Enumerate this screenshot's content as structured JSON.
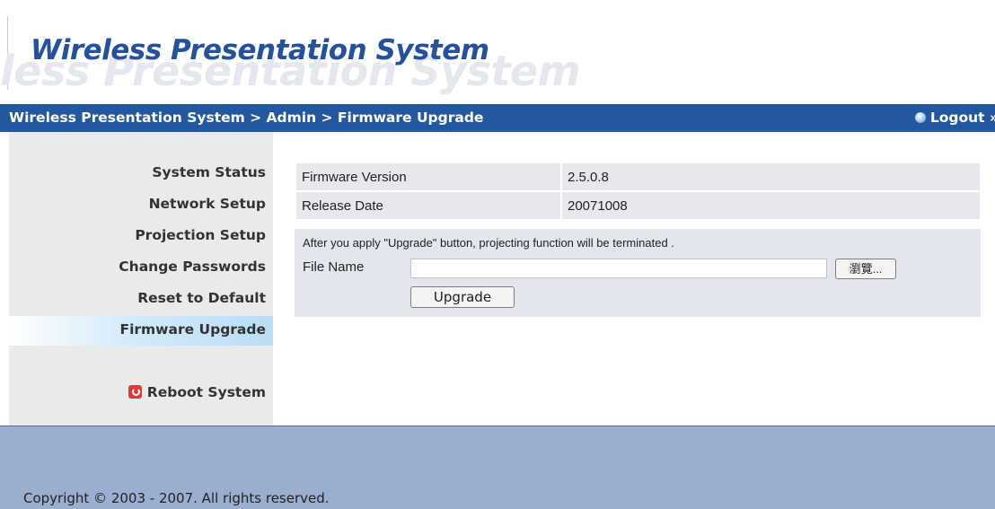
{
  "header": {
    "brand_watermark": "less Presentation System",
    "brand_title": "Wireless Presentation System"
  },
  "navbar": {
    "breadcrumb": "Wireless Presentation System > Admin > Firmware Upgrade",
    "logout_label": "Logout »"
  },
  "sidebar": {
    "items": [
      {
        "label": "System Status"
      },
      {
        "label": "Network Setup"
      },
      {
        "label": "Projection Setup"
      },
      {
        "label": "Change Passwords"
      },
      {
        "label": "Reset to Default"
      },
      {
        "label": "Firmware Upgrade",
        "active": true
      }
    ],
    "reboot_label": "Reboot System"
  },
  "firmware": {
    "version_label": "Firmware Version",
    "version_value": "2.5.0.8",
    "release_label": "Release Date",
    "release_value": "20071008",
    "notice": "After you apply \"Upgrade\" button, projecting function will be terminated .",
    "file_label": "File Name",
    "file_value": "",
    "browse_label": "瀏覽...",
    "upgrade_label": "Upgrade"
  },
  "footer": {
    "copyright": "Copyright © 2003 - 2007. All rights reserved."
  },
  "colors": {
    "navbar": "#23579e",
    "brand": "#24519a",
    "sidebar": "#eaeaea",
    "footer": "#9caed0",
    "active_highlight": "#b9def6"
  }
}
